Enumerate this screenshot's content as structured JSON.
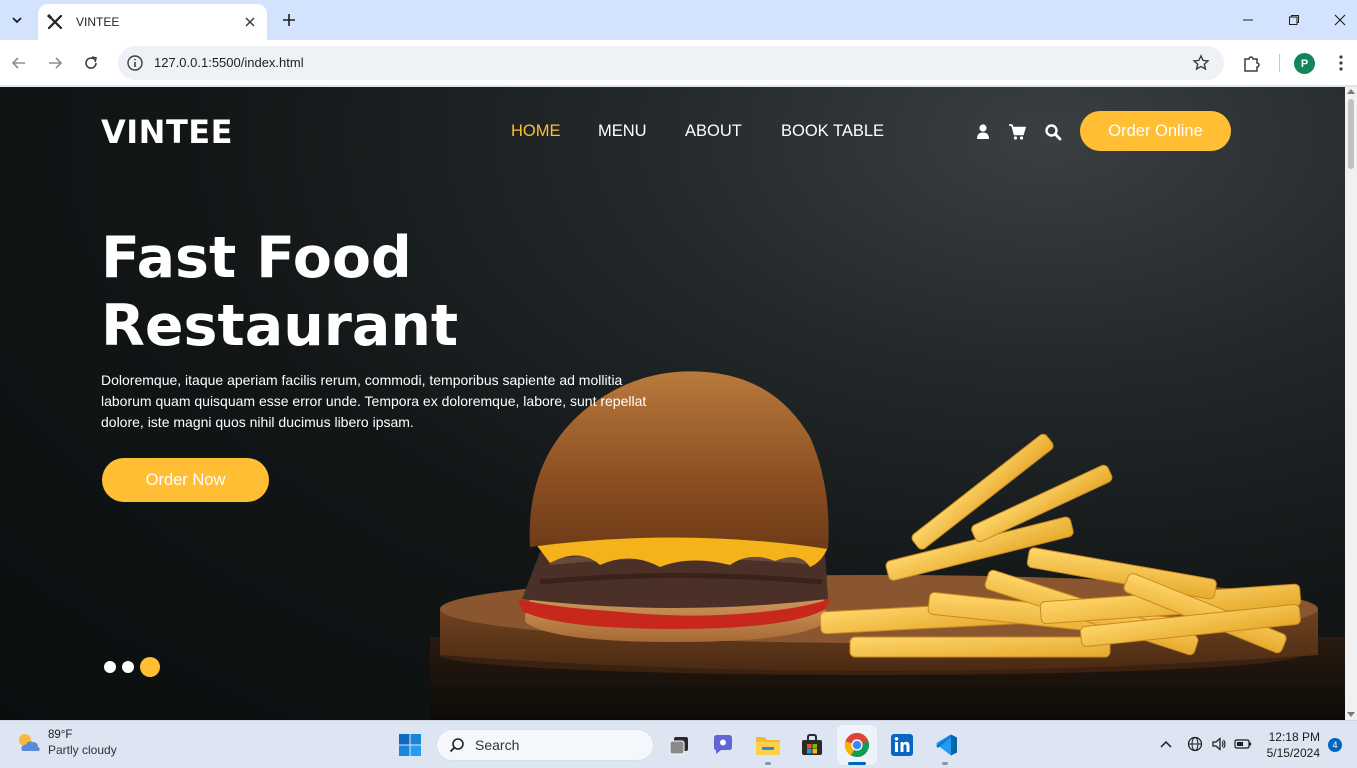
{
  "browser": {
    "tab_title": "VINTEE",
    "url": "127.0.0.1:5500/index.html",
    "profile_initial": "P"
  },
  "site": {
    "brand": "VINTEE",
    "nav": [
      {
        "label": "HOME",
        "active": true
      },
      {
        "label": "MENU",
        "active": false
      },
      {
        "label": "ABOUT",
        "active": false
      },
      {
        "label": "BOOK TABLE",
        "active": false
      }
    ],
    "header_icons": [
      "user-icon",
      "cart-icon",
      "search-icon"
    ],
    "order_online": "Order Online",
    "hero": {
      "title_line1": "Fast Food",
      "title_line2": "Restaurant",
      "text": "Doloremque, itaque aperiam facilis rerum, commodi, temporibus sapiente ad mollitia laborum quam quisquam esse error unde. Tempora ex doloremque, labore, sunt repellat dolore, iste magni quos nihil ducimus libero ipsam.",
      "cta": "Order Now"
    },
    "carousel": {
      "count": 3,
      "active_index": 3
    }
  },
  "colors": {
    "accent": "#ffbe33",
    "hero_bg": "#0b0e0f",
    "taskbar": "#dde5f2",
    "chrome_tabbar": "#d3e3fd"
  },
  "taskbar": {
    "weather_temp": "89°F",
    "weather_cond": "Partly cloudy",
    "search_label": "Search",
    "apps": [
      "start-icon",
      "search",
      "task-view-icon",
      "chat-icon",
      "file-explorer-icon",
      "store-icon",
      "chrome-icon",
      "linkedin-icon",
      "vscode-icon"
    ],
    "time": "12:18 PM",
    "date": "5/15/2024",
    "notifications": "4"
  }
}
